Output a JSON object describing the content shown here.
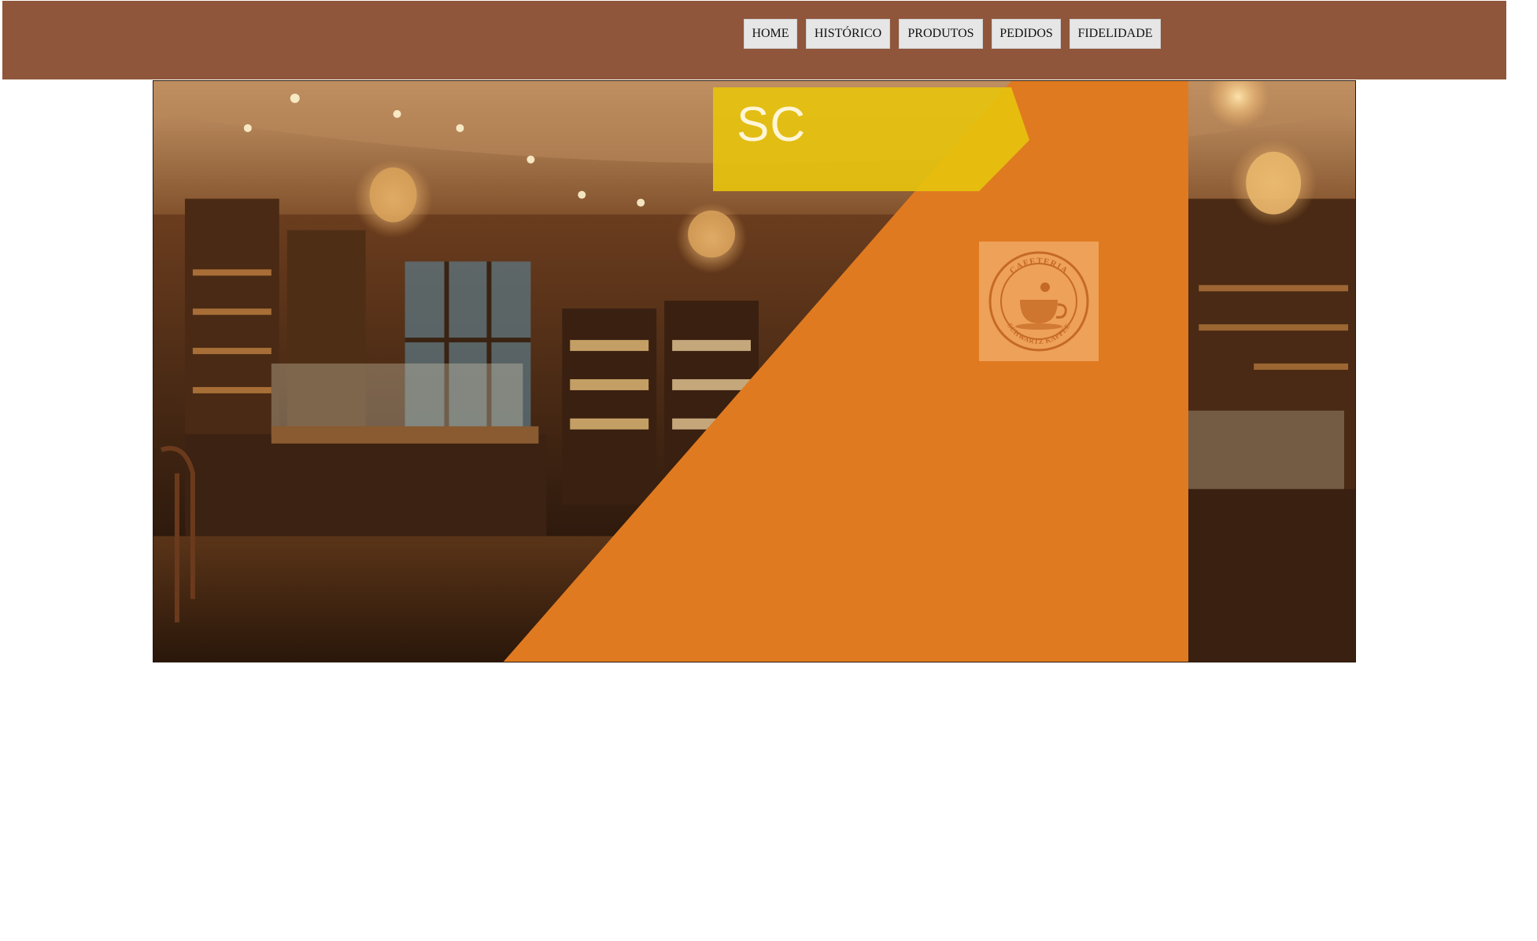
{
  "nav": {
    "items": [
      {
        "label": "HOME"
      },
      {
        "label": "HISTÓRICO"
      },
      {
        "label": "PRODUTOS"
      },
      {
        "label": "PEDIDOS"
      },
      {
        "label": "FIDELIDADE"
      }
    ]
  },
  "hero": {
    "logo_text": "SC",
    "badge_top_text": "CAFETERIA",
    "badge_bottom_text": "SCHWARTZ KAFFEE"
  },
  "colors": {
    "topbar": "#8f563b",
    "orange": "#e07a20",
    "yellow_banner": "#e6c20e",
    "nav_button": "#e6e6e6"
  }
}
